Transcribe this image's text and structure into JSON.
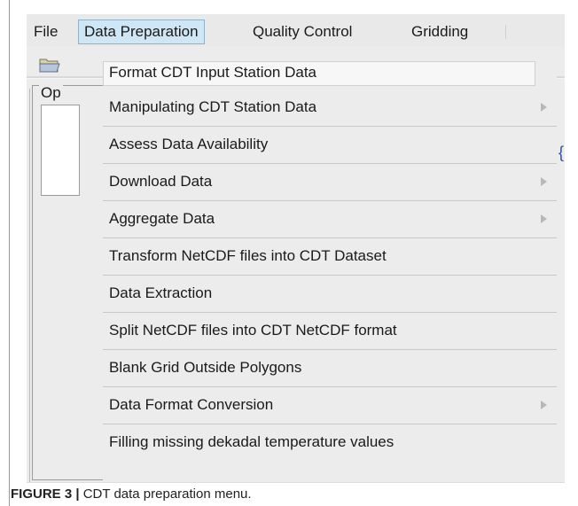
{
  "menubar": {
    "items": [
      "File",
      "Data Preparation",
      "Quality Control",
      "Gridding"
    ]
  },
  "options_panel": {
    "label": "Op"
  },
  "dropdown": {
    "items": [
      {
        "label": "Format CDT Input Station Data",
        "submenu": false
      },
      {
        "label": "Manipulating CDT Station Data",
        "submenu": true
      },
      {
        "label": "Assess Data Availability",
        "submenu": false
      },
      {
        "label": "Download Data",
        "submenu": true
      },
      {
        "label": "Aggregate Data",
        "submenu": true
      },
      {
        "label": "Transform NetCDF files into CDT Dataset",
        "submenu": false
      },
      {
        "label": "Data Extraction",
        "submenu": false
      },
      {
        "label": "Split NetCDF files into CDT NetCDF format",
        "submenu": false
      },
      {
        "label": "Blank Grid Outside Polygons",
        "submenu": false
      },
      {
        "label": "Data Format Conversion",
        "submenu": true
      },
      {
        "label": "Filling missing dekadal temperature values",
        "submenu": false
      }
    ]
  },
  "caption": {
    "label": "FIGURE 3 |",
    "text": " CDT data preparation menu."
  },
  "colors": {
    "highlight": "#cfe6f4",
    "menu_background": "#ececec",
    "submenu_arrow": "#b8b8b8"
  }
}
